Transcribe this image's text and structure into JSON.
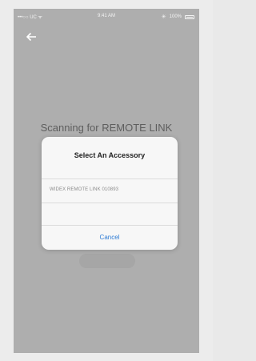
{
  "status_bar": {
    "carrier": "•••○○ UC ᯤ",
    "time": "9:41 AM",
    "battery": "100%"
  },
  "screen": {
    "scanning_title": "Scanning for REMOTE LINK"
  },
  "dialog": {
    "title": "Select An Accessory",
    "accessories": [
      "WIDEX REMOTE LINK 010893"
    ],
    "cancel_label": "Cancel"
  },
  "colors": {
    "accent": "#2d7bd5",
    "overlay_background": "#aeaeae",
    "dialog_background": "#f7f7f7"
  },
  "icons": {
    "back": "back-arrow-icon",
    "bluetooth": "bluetooth-icon",
    "battery": "battery-icon"
  }
}
